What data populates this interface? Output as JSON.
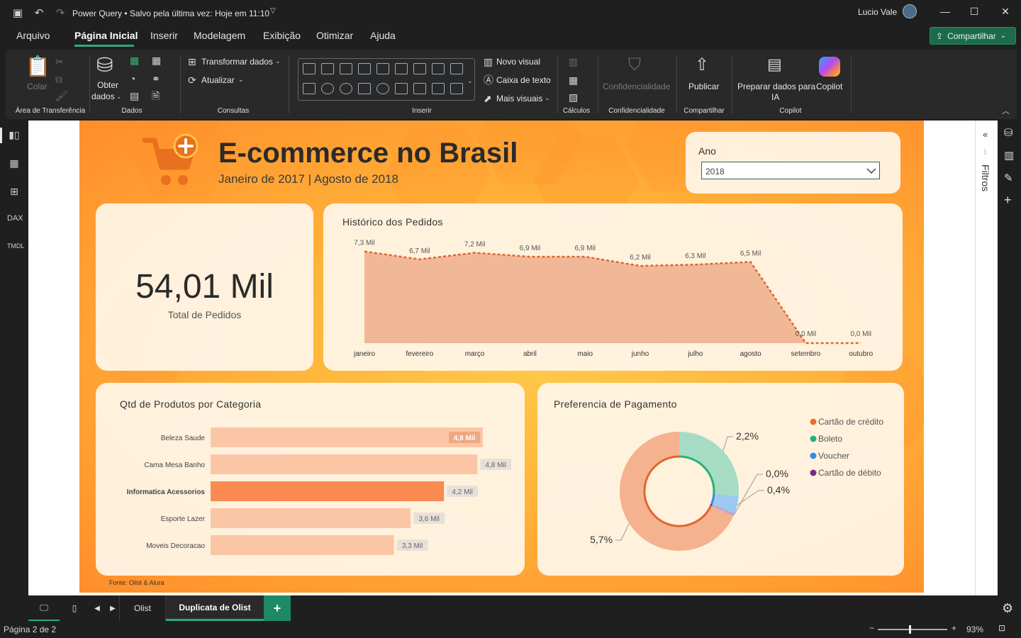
{
  "window": {
    "title": "Power Query • Salvo pela última vez: Hoje em 11:10",
    "user": "Lucio Vale"
  },
  "menu": {
    "items": [
      "Arquivo",
      "Página Inicial",
      "Inserir",
      "Modelagem",
      "Exibição",
      "Otimizar",
      "Ajuda"
    ],
    "share": "Compartilhar"
  },
  "ribbon": {
    "paste": "Colar",
    "clipboard_group": "Área de Transferência",
    "get_data_1": "Obter",
    "get_data_2": "dados",
    "data_group": "Dados",
    "transform": "Transformar dados",
    "refresh": "Atualizar",
    "queries_group": "Consultas",
    "insert_group": "Inserir",
    "new_visual": "Novo visual",
    "text_box": "Caixa de texto",
    "more_visuals": "Mais visuais",
    "calc_group": "Cálculos",
    "sensitivity": "Confidencialidade",
    "sensitivity_group": "Confidencialidade",
    "publish": "Publicar",
    "share_group": "Compartilhar",
    "copilot_prep_1": "Preparar dados para",
    "copilot_prep_2": "IA",
    "copilot": "Copilot",
    "copilot_group": "Copilot"
  },
  "report": {
    "title": "E-commerce no Brasil",
    "subtitle": "Janeiro de 2017 | Agosto de 2018",
    "year_filter": {
      "label": "Ano",
      "value": "2018"
    },
    "kpi": {
      "value": "54,01 Mil",
      "label": "Total de Pedidos"
    },
    "history_title": "Histórico dos Pedidos",
    "category_title": "Qtd de Produtos por Categoria",
    "payment_title": "Preferencia de Pagamento",
    "source": "Fonte: Olist & Alura"
  },
  "right_pane": {
    "filters": "Filtros"
  },
  "tabs": [
    "Olist",
    "Duplicata de Olist"
  ],
  "status": {
    "page": "Página 2 de 2",
    "zoom": "93%"
  },
  "chart_data": [
    {
      "type": "area",
      "title": "Histórico dos Pedidos",
      "categories": [
        "janeiro",
        "fevereiro",
        "março",
        "abril",
        "maio",
        "junho",
        "julho",
        "agosto",
        "setembro",
        "outubro"
      ],
      "values": [
        7.3,
        6.7,
        7.2,
        6.9,
        6.9,
        6.2,
        6.3,
        6.5,
        0.0,
        0.0
      ],
      "data_labels": [
        "7,3 Mil",
        "6,7 Mil",
        "7,2 Mil",
        "6,9 Mil",
        "6,9 Mil",
        "6,2 Mil",
        "6,3 Mil",
        "6,5 Mil",
        "0,0 Mil",
        "0,0 Mil"
      ],
      "colors": {
        "fill": "#f0b493",
        "line": "#e0662e"
      }
    },
    {
      "type": "bar",
      "title": "Qtd de Produtos por Categoria",
      "orientation": "horizontal",
      "categories": [
        "Beleza Saude",
        "Cama Mesa Banho",
        "Informatica Acessorios",
        "Esporte Lazer",
        "Moveis Decoracao"
      ],
      "values": [
        4.9,
        4.8,
        4.2,
        3.6,
        3.3
      ],
      "data_labels": [
        "4,9 Mil",
        "4,8 Mil",
        "4,2 Mil",
        "3,6 Mil",
        "3,3 Mil"
      ],
      "highlight": "Informatica Acessorios",
      "colors": {
        "bar": "#fbc6a6",
        "highlight": "#fb8a52"
      }
    },
    {
      "type": "pie",
      "title": "Preferencia de Pagamento",
      "labels": [
        "Cartão de crédito",
        "Boleto",
        "Voucher",
        "Cartão de débito"
      ],
      "values": [
        5.7,
        2.2,
        0.4,
        0.0
      ],
      "data_labels": [
        "5,7%",
        "2,2%",
        "0,4%",
        "0,0%"
      ],
      "colors": [
        "#f4b28f",
        "#28b07d",
        "#2f8fe6",
        "#7a2a8a"
      ]
    }
  ]
}
